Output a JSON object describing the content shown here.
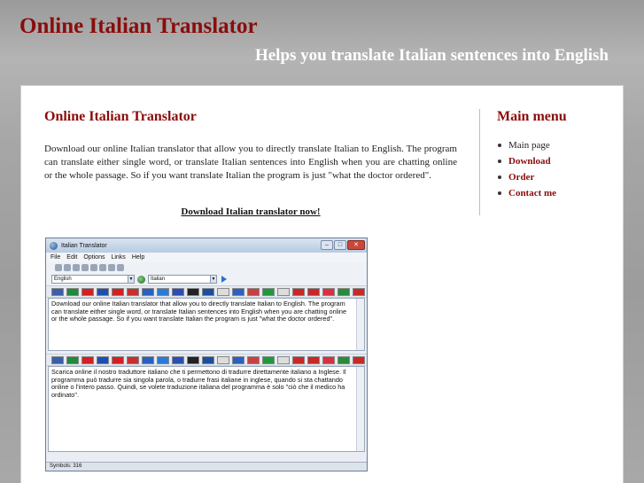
{
  "site": {
    "title": "Online Italian Translator",
    "tagline": "Helps you translate Italian sentences into English"
  },
  "main": {
    "heading": "Online Italian Translator",
    "body": "Download our online Italian translator that allow you to directly translate Italian to English. The program can translate either single word, or translate Italian sentences into English when you are chatting online or the whole passage. So if you want translate Italian the program is just \"what the doctor ordered\".",
    "download_link": "Download Italian translator now!"
  },
  "menu": {
    "heading": "Main menu",
    "items": [
      {
        "label": "Main page"
      },
      {
        "label": "Download"
      },
      {
        "label": "Order"
      },
      {
        "label": "Contact me"
      }
    ]
  },
  "app": {
    "title": "Italian Translator",
    "menubar": [
      "File",
      "Edit",
      "Options",
      "Links",
      "Help"
    ],
    "source_lang": "English",
    "target_lang": "Italian",
    "source_text": "Download our online Italian translator that allow you to directly translate Italian to English. The program can translate either single word, or translate Italian sentences into English when you are chatting online or the whole passage. So if you want translate Italian the program is just \"what the doctor ordered\".",
    "target_text": "Scarica online il nostro traduttore italiano che ti permettono di tradurre direttamente italiano a Inglese. Il programma può tradurre sia singola parola, o tradurre frasi italiane in inglese, quando si sta chattando online o l'intero passo. Quindi, se volete traduzione italiana del programma è solo \"ciò che il medico ha ordinato\".",
    "status": "Symbols: 316",
    "flag_colors": [
      "#3a5fa8",
      "#1e8a3a",
      "#d42020",
      "#1e4fb0",
      "#d42020",
      "#c83030",
      "#2a5fc0",
      "#2a7ad8",
      "#2a4fb0",
      "#222222",
      "#1a4fa0",
      "#dddddd",
      "#2a60c0",
      "#c84040",
      "#1e9a3a",
      "#dddddd",
      "#c82828",
      "#c82828",
      "#d83040",
      "#2a8a3a",
      "#c82828"
    ]
  }
}
